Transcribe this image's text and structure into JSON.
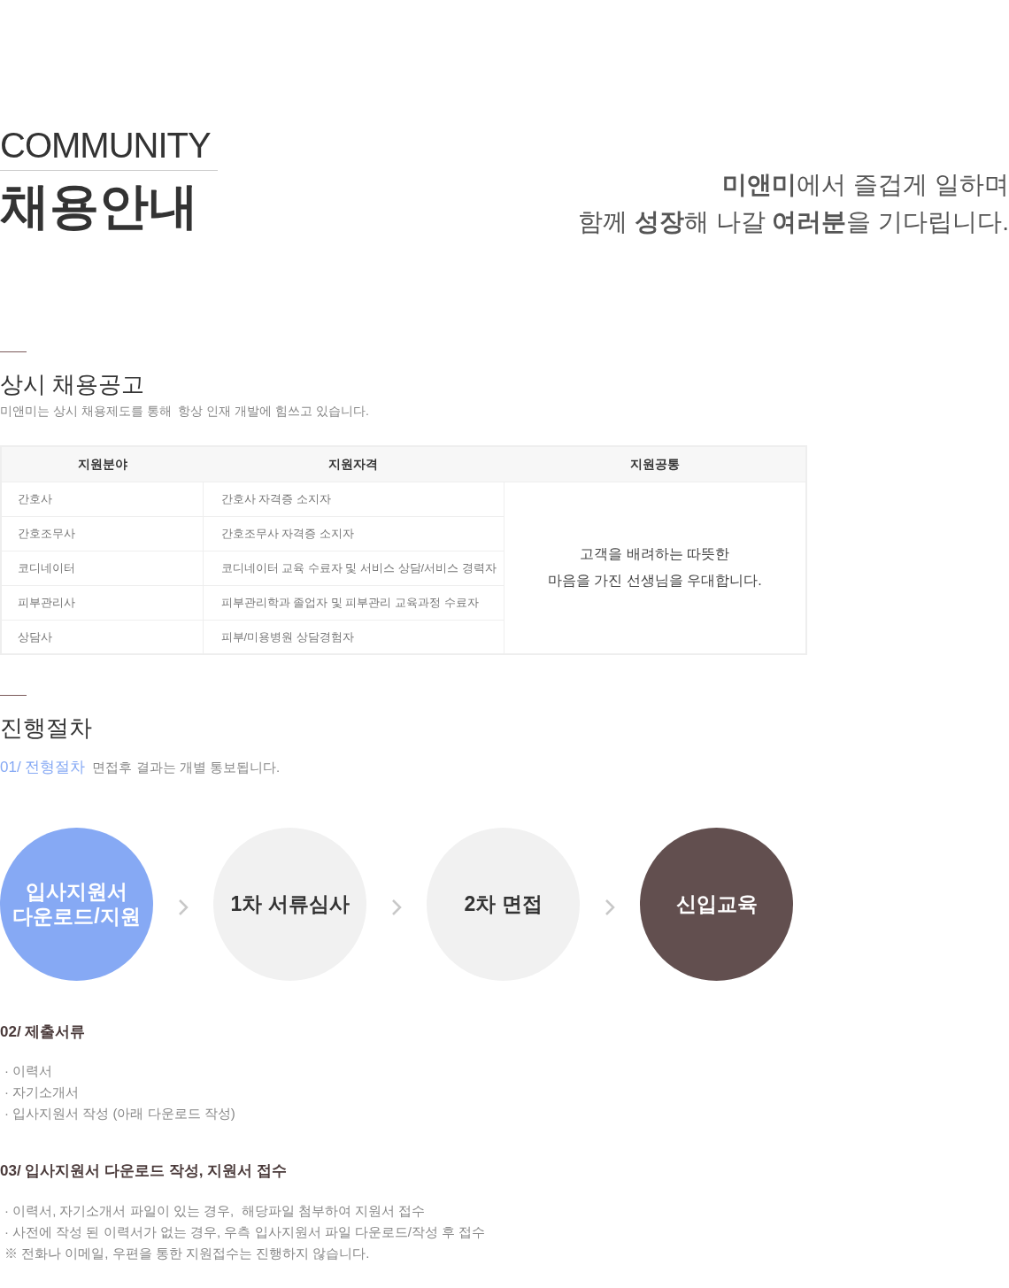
{
  "header": {
    "eyebrow": "COMMUNITY",
    "title": "채용안내",
    "tagline": [
      "**미앤미**에서 즐겁게 일하며",
      "함께 **성장**해 나갈 **여러분**을 기다립니다."
    ]
  },
  "recruit": {
    "title": "상시 채용공고",
    "description": "미앤미는 상시 채용제도를 통해  항상 인재 개발에 힘쓰고 있습니다.",
    "table": {
      "columns": [
        "지원분야",
        "지원자격",
        "지원공통"
      ],
      "rows": [
        {
          "field": "간호사",
          "qualification": "간호사 자격증 소지자"
        },
        {
          "field": "간호조무사",
          "qualification": "간호조무사 자격증 소지자"
        },
        {
          "field": "코디네이터",
          "qualification": "코디네이터 교육 수료자 및 서비스 상담/서비스 경력자"
        },
        {
          "field": "피부관리사",
          "qualification": "피부관리학과 졸업자 및 피부관리 교육과정 수료자"
        },
        {
          "field": "상담사",
          "qualification": "피부/미용병원 상담경험자"
        }
      ],
      "common": [
        "고객을 배려하는 따뜻한",
        "마음을 가진 선생님을 우대합니다."
      ]
    }
  },
  "process": {
    "title": "진행절차",
    "step_heading": {
      "number": "01/",
      "label": "전형절차",
      "note": "면접후 결과는 개별 통보됩니다."
    },
    "steps": [
      {
        "label": [
          "입사지원서",
          "다운로드/지원"
        ],
        "kind": "highlight"
      },
      {
        "label": [
          "1차 서류심사"
        ],
        "kind": "plain"
      },
      {
        "label": [
          "2차 면접"
        ],
        "kind": "plain"
      },
      {
        "label": [
          "신입교육"
        ],
        "kind": "dark"
      }
    ],
    "sections": [
      {
        "number": "02/",
        "title": "제출서류",
        "lines": [
          "· 이력서",
          "· 자기소개서",
          "· 입사지원서 작성 (아래 다운로드 작성)"
        ]
      },
      {
        "number": "03/",
        "title": "입사지원서 다운로드 작성, 지원서 접수",
        "lines": [
          "· 이력서, 자기소개서 파일이 있는 경우,  해당파일 첨부하여 지원서 접수",
          "· 사전에 작성 된 이력서가 없는 경우, 우측 입사지원서 파일 다운로드/작성 후 접수",
          "※ 전화나 이메일, 우편을 통한 지원접수는 진행하지 않습니다."
        ]
      }
    ]
  }
}
